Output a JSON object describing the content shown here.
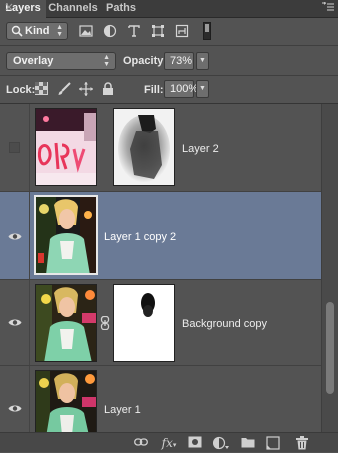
{
  "tabs": [
    {
      "label": "Layers",
      "active": true
    },
    {
      "label": "Channels",
      "active": false
    },
    {
      "label": "Paths",
      "active": false
    }
  ],
  "filter": {
    "kind_label": "Kind",
    "icons": [
      "image-filter-icon",
      "adjustment-filter-icon",
      "type-filter-icon",
      "shape-filter-icon",
      "smart-object-filter-icon"
    ]
  },
  "blend": {
    "mode": "Overlay",
    "opacity_label": "Opacity:",
    "opacity_value": "73%"
  },
  "lock": {
    "label": "Lock:",
    "icons": [
      "lock-transparent-pixels-icon",
      "lock-image-pixels-icon",
      "lock-position-icon",
      "lock-all-icon"
    ],
    "fill_label": "Fill:",
    "fill_value": "100%"
  },
  "layers": [
    {
      "name": "Layer 2",
      "visible": false,
      "selected": false,
      "has_mask": true
    },
    {
      "name": "Layer 1 copy 2",
      "visible": true,
      "selected": true,
      "has_mask": false
    },
    {
      "name": "Background copy",
      "visible": true,
      "selected": false,
      "has_mask": true,
      "linked": true
    },
    {
      "name": "Layer 1",
      "visible": true,
      "selected": false,
      "has_mask": false
    }
  ],
  "bottom_bar": {
    "icons": [
      "link-layers-icon",
      "fx-icon",
      "add-mask-icon",
      "new-adjustment-layer-icon",
      "new-group-icon",
      "new-layer-icon",
      "delete-layer-icon"
    ],
    "fx_label": "fx"
  },
  "colors": {
    "panel": "#535353",
    "selected_row": "#6a7a96"
  }
}
